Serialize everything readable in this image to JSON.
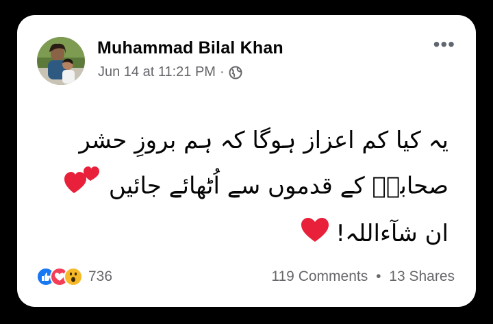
{
  "post": {
    "author": "Muhammad Bilal Khan",
    "timestamp": "Jun 14 at 11:21 PM",
    "separator": "·",
    "more_menu": "•••",
    "text_lines": [
      "یہ کیا کم اعزاز ہوگا کہ ہم بروزِ حشر",
      "صحابہؓ کے قدموں سے اُٹھائے جائیں",
      "ان شآءاللہ!"
    ],
    "icons": {
      "audience": "globe-icon",
      "reactions": [
        "like-icon",
        "love-icon",
        "wow-icon"
      ],
      "emoji": [
        "two-hearts-icon",
        "red-heart-icon"
      ]
    }
  },
  "footer": {
    "reaction_count": "736",
    "comments": "119 Comments",
    "shares": "13 Shares",
    "separator": "•"
  },
  "colors": {
    "background": "#000000",
    "card": "#ffffff",
    "heart_red": "#e8203a",
    "like_blue": "#1877f2",
    "love_red": "#f33e58",
    "wow_yellow": "#f7b928",
    "muted_text": "#65676b"
  }
}
